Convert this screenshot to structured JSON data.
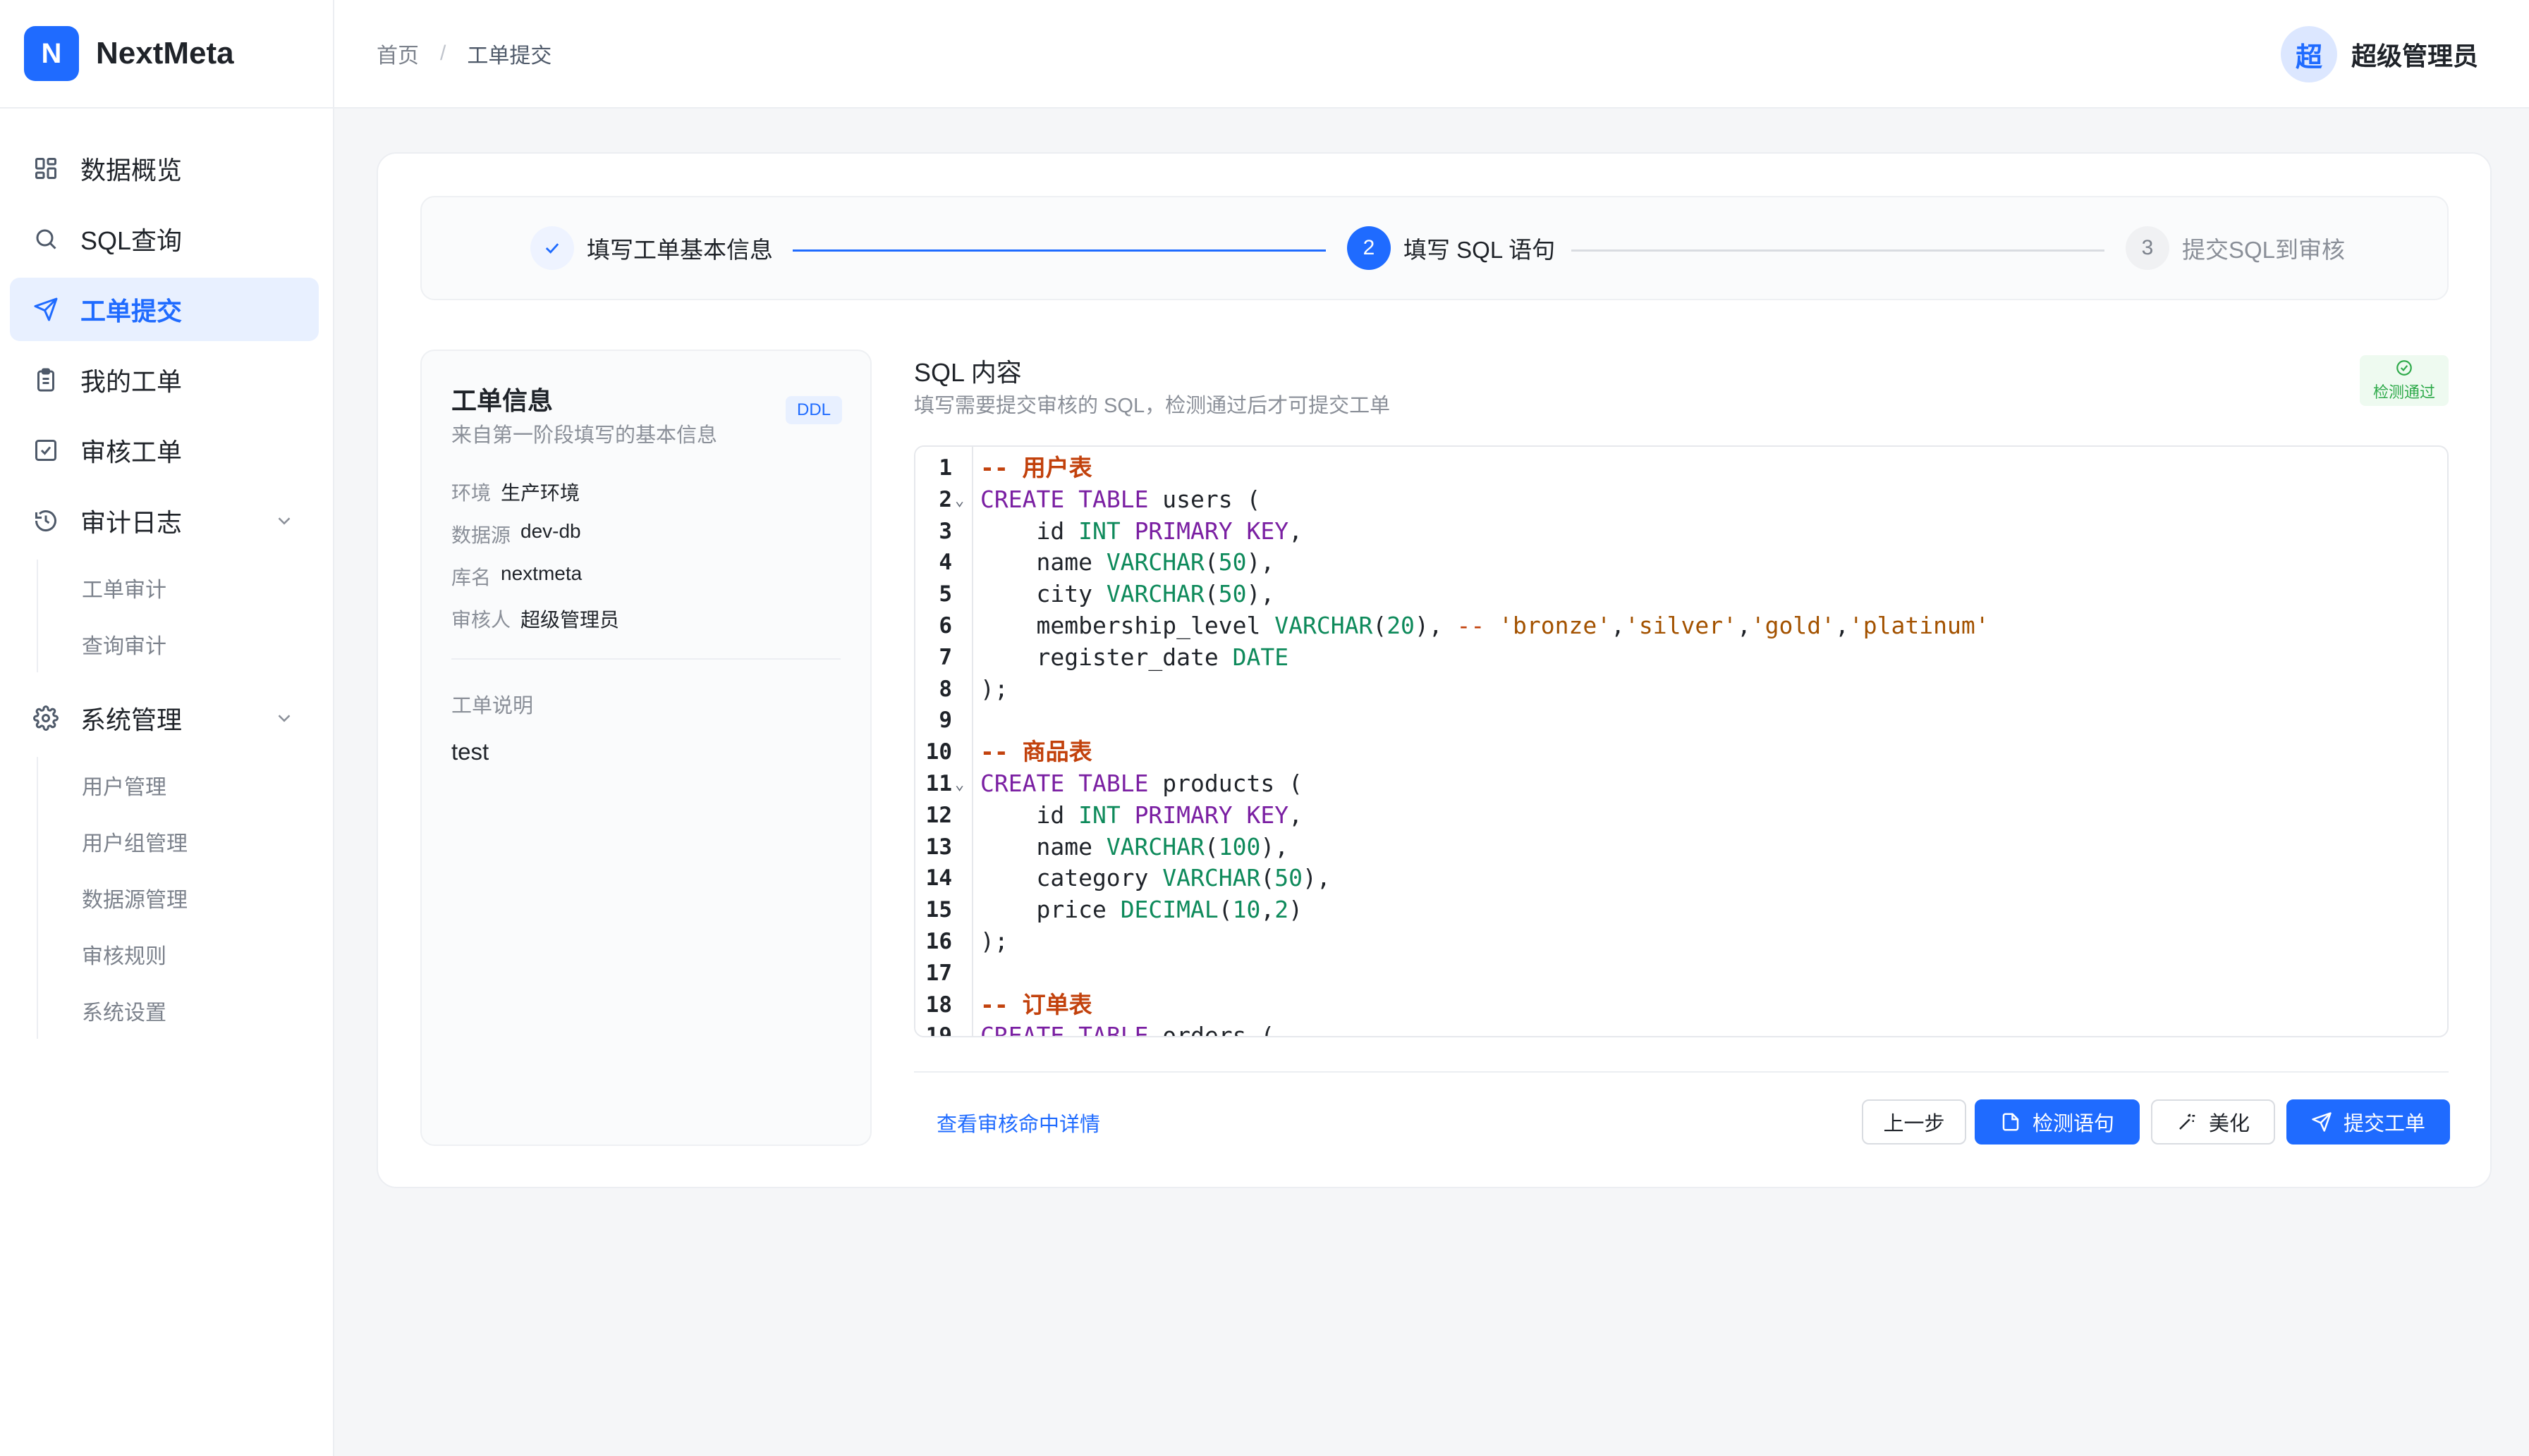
{
  "app": {
    "logo_letter": "N",
    "name": "NextMeta",
    "brand_color": "#1f6bff"
  },
  "header": {
    "breadcrumb": [
      "首页",
      "工单提交"
    ],
    "breadcrumb_sep": "/",
    "user": {
      "avatar_text": "超",
      "name": "超级管理员"
    }
  },
  "sidebar": {
    "items": [
      {
        "label": "数据概览",
        "icon": "dashboard-icon"
      },
      {
        "label": "SQL查询",
        "icon": "search-icon"
      },
      {
        "label": "工单提交",
        "icon": "send-icon",
        "active": true
      },
      {
        "label": "我的工单",
        "icon": "clipboard-icon"
      },
      {
        "label": "审核工单",
        "icon": "check-square-icon"
      },
      {
        "label": "审计日志",
        "icon": "history-icon",
        "expanded": true,
        "children": [
          "工单审计",
          "查询审计"
        ]
      },
      {
        "label": "系统管理",
        "icon": "gear-icon",
        "expanded": true,
        "children": [
          "用户管理",
          "用户组管理",
          "数据源管理",
          "审核规则",
          "系统设置"
        ]
      }
    ]
  },
  "steps": [
    {
      "index": "1",
      "label": "填写工单基本信息",
      "status": "done"
    },
    {
      "index": "2",
      "label": "填写 SQL 语句",
      "status": "active"
    },
    {
      "index": "3",
      "label": "提交SQL到审核",
      "status": "wait"
    }
  ],
  "info": {
    "title": "工单信息",
    "subtitle": "来自第一阶段填写的基本信息",
    "tag": "DDL",
    "fields": [
      {
        "key": "环境",
        "value": "生产环境"
      },
      {
        "key": "数据源",
        "value": "dev-db"
      },
      {
        "key": "库名",
        "value": "nextmeta"
      },
      {
        "key": "审核人",
        "value": "超级管理员"
      }
    ],
    "desc_label": "工单说明",
    "desc_value": "test"
  },
  "sql": {
    "title": "SQL 内容",
    "subtitle": "填写需要提交审核的 SQL，检测通过后才可提交工单",
    "status_badge": "检测通过",
    "status_color": "#2eaa4a",
    "lines": [
      "-- 用户表",
      "CREATE TABLE users (",
      "    id INT PRIMARY KEY,",
      "    name VARCHAR(50),",
      "    city VARCHAR(50),",
      "    membership_level VARCHAR(20), -- 'bronze','silver','gold','platinum'",
      "    register_date DATE",
      ");",
      "",
      "-- 商品表",
      "CREATE TABLE products (",
      "    id INT PRIMARY KEY,",
      "    name VARCHAR(100),",
      "    category VARCHAR(50),",
      "    price DECIMAL(10,2)",
      ");",
      "",
      "-- 订单表",
      "CREATE TABLE orders ("
    ],
    "fold_lines": [
      2,
      11
    ]
  },
  "footer": {
    "detail_link": "查看审核命中详情",
    "buttons": {
      "prev": "上一步",
      "check": "检测语句",
      "beautify": "美化",
      "submit": "提交工单"
    }
  }
}
